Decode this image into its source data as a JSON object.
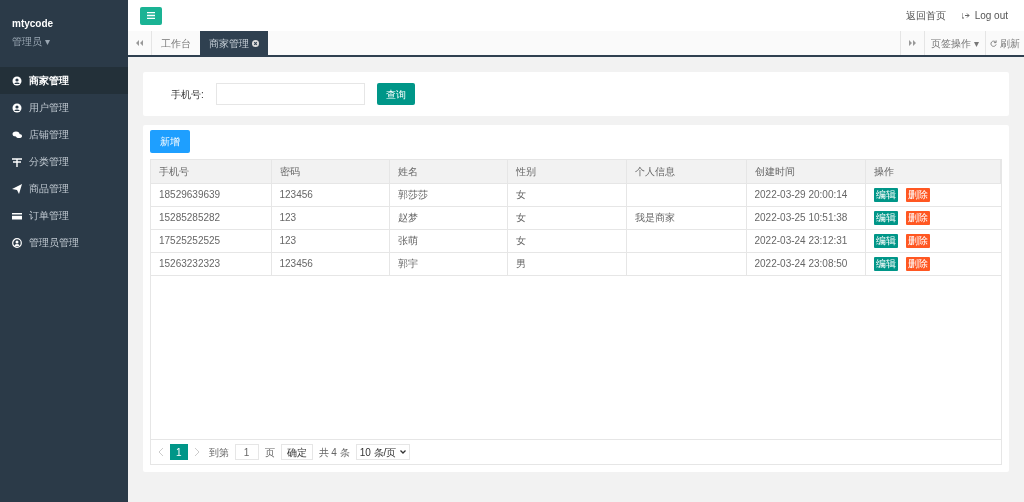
{
  "brand": {
    "name": "mtycode",
    "role": "管理员 ▾"
  },
  "sidebar": {
    "items": [
      {
        "label": "商家管理",
        "selected": true
      },
      {
        "label": "用户管理",
        "selected": false
      },
      {
        "label": "店铺管理",
        "selected": false
      },
      {
        "label": "分类管理",
        "selected": false
      },
      {
        "label": "商品管理",
        "selected": false
      },
      {
        "label": "订单管理",
        "selected": false
      },
      {
        "label": "管理员管理",
        "selected": false
      }
    ]
  },
  "header": {
    "links": [
      "返回首页",
      "Log out"
    ]
  },
  "tabs": [
    {
      "label": "工作台",
      "selected": false,
      "closable": false
    },
    {
      "label": "商家管理",
      "selected": true,
      "closable": true
    }
  ],
  "tab_tools": [
    "页签操作 ▾",
    "刷新"
  ],
  "search": {
    "label": "手机号:",
    "button": "查询"
  },
  "add_button": "新增",
  "table": {
    "columns": [
      "手机号",
      "密码",
      "姓名",
      "性别",
      "个人信息",
      "创建时间",
      "操作"
    ],
    "rows": [
      {
        "cells": [
          "18529639639",
          "123456",
          "郭莎莎",
          "女",
          "",
          "2022-03-29 20:00:14"
        ],
        "actions": [
          "编辑",
          "删除"
        ]
      },
      {
        "cells": [
          "15285285282",
          "123",
          "赵梦",
          "女",
          "我是商家",
          "2022-03-25 10:51:38"
        ],
        "actions": [
          "编辑",
          "删除"
        ]
      },
      {
        "cells": [
          "17525252525",
          "123",
          "张萌",
          "女",
          "",
          "2022-03-24 23:12:31"
        ],
        "actions": [
          "编辑",
          "删除"
        ]
      },
      {
        "cells": [
          "15263232323",
          "123456",
          "郭宇",
          "男",
          "",
          "2022-03-24 23:08:50"
        ],
        "actions": [
          "编辑",
          "删除"
        ]
      }
    ]
  },
  "pager": {
    "pages": [
      {
        "label": "1",
        "selected": true
      }
    ],
    "goto_label": "到第",
    "goto_value": "1",
    "page_unit": "页",
    "confirm": "确定",
    "total": "共 4 条",
    "page_size": "10 条/页"
  }
}
